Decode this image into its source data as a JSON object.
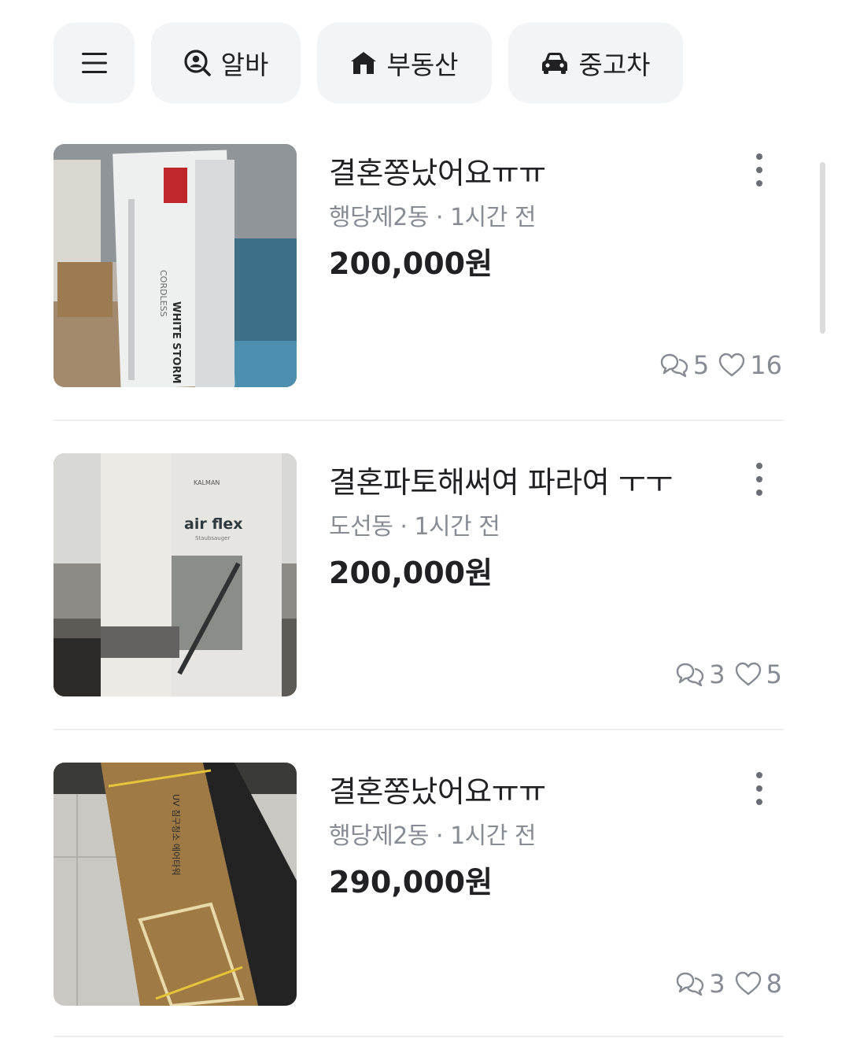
{
  "categories": [
    {
      "label": "알바",
      "icon": "search-person-icon"
    },
    {
      "label": "부동산",
      "icon": "house-icon"
    },
    {
      "label": "중고차",
      "icon": "car-icon"
    }
  ],
  "listings": [
    {
      "title": "결혼쫑났어요ㅠㅠ",
      "meta": "행당제2동 · 1시간 전",
      "price": "200,000원",
      "comments": "5",
      "likes": "16"
    },
    {
      "title": "결혼파토해써여 파라여 ㅜㅜ",
      "meta": "도선동 · 1시간 전",
      "price": "200,000원",
      "comments": "3",
      "likes": "5"
    },
    {
      "title": "결혼쫑났어요ㅠㅠ",
      "meta": "행당제2동 · 1시간 전",
      "price": "290,000원",
      "comments": "3",
      "likes": "8"
    }
  ],
  "images": {
    "box1": [
      "WHITE STORM",
      "CORDLESS"
    ],
    "box2": [
      "KALMAN",
      "air flex",
      "Staubsauger"
    ],
    "box3": [
      "UV 침구청소 에어타워"
    ]
  },
  "colors": {
    "chip_bg": "#f3f4f6",
    "muted_text": "#868b94",
    "text": "#212124",
    "divider": "#eeeeee"
  }
}
